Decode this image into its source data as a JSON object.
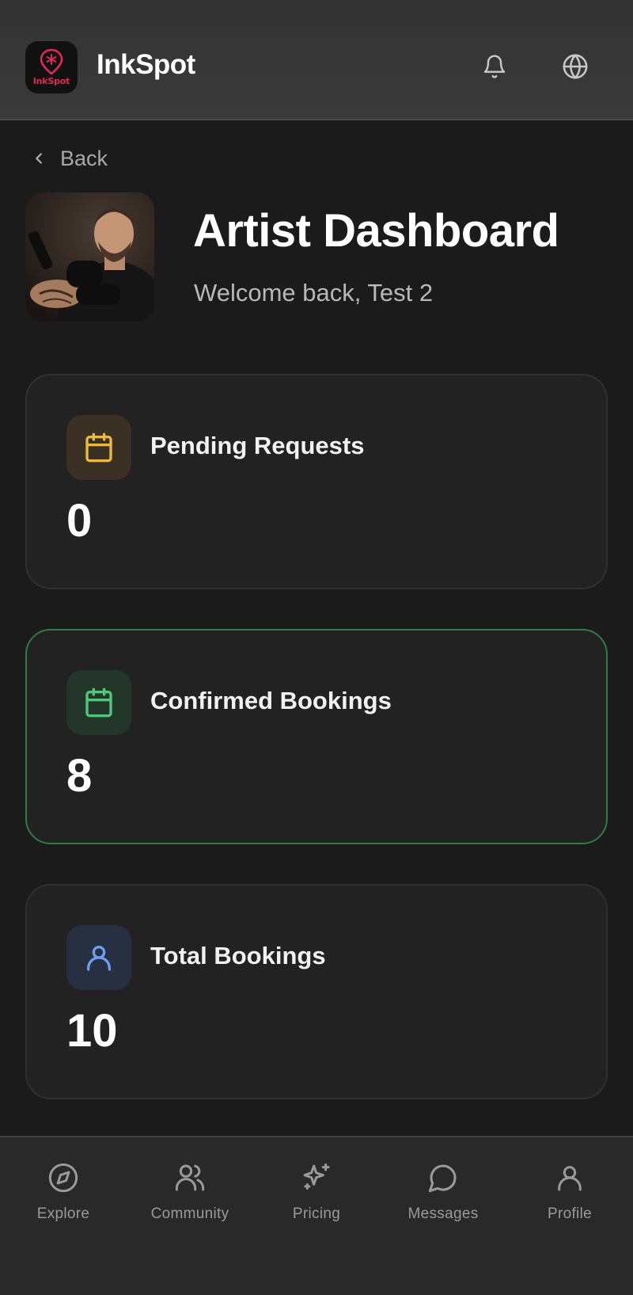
{
  "header": {
    "logo_text": "InkSpot",
    "brand": "InkSpot",
    "icons": [
      "bell-icon",
      "globe-icon"
    ]
  },
  "back": {
    "label": "Back"
  },
  "profile": {
    "title": "Artist Dashboard",
    "welcome": "Welcome back, Test 2"
  },
  "cards": [
    {
      "label": "Pending Requests",
      "value": "0",
      "icon": "calendar-icon",
      "accent": "#e9b949"
    },
    {
      "label": "Confirmed Bookings",
      "value": "8",
      "icon": "calendar-icon",
      "accent": "#55c57a"
    },
    {
      "label": "Total Bookings",
      "value": "10",
      "icon": "user-icon",
      "accent": "#6d9ff0"
    }
  ],
  "nav": [
    {
      "label": "Explore",
      "icon": "compass-icon"
    },
    {
      "label": "Community",
      "icon": "users-icon"
    },
    {
      "label": "Pricing",
      "icon": "sparkles-icon"
    },
    {
      "label": "Messages",
      "icon": "message-circle-icon"
    },
    {
      "label": "Profile",
      "icon": "user-icon"
    }
  ],
  "colors": {
    "background": "#1b1b1b",
    "header": "#363636",
    "brand_accent": "#e2285a",
    "confirmed_border": "#2f7a47"
  }
}
